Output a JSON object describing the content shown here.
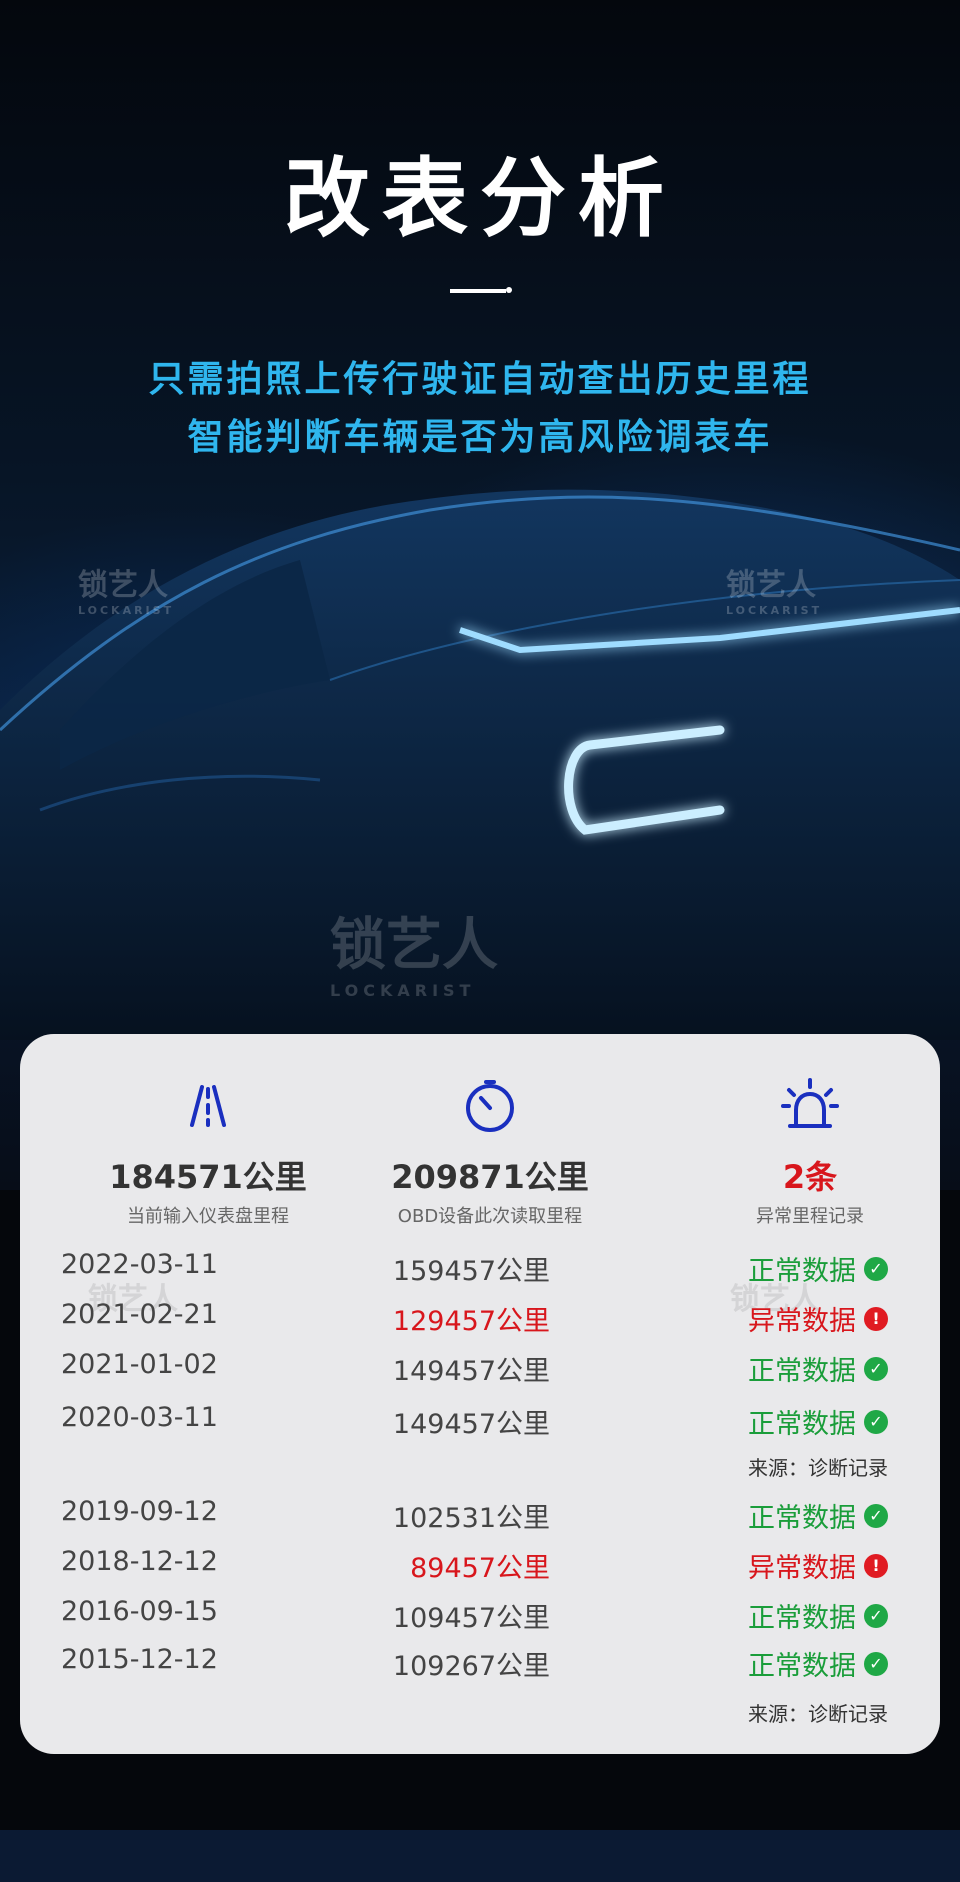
{
  "hero": {
    "title": "改表分析",
    "subtitle_line1": "只需拍照上传行驶证自动查出历史里程",
    "subtitle_line2": "智能判断车辆是否为高风险调表车",
    "watermark": "锁艺人",
    "watermark_sub": "LOCKARIST"
  },
  "colors": {
    "accent": "#2fb6ee",
    "ok": "#1a9d3a",
    "alert": "#d8161c"
  },
  "stats": [
    {
      "icon": "road-icon",
      "value": "184571公里",
      "caption": "当前输入仪表盘里程",
      "highlight": false
    },
    {
      "icon": "stopwatch-icon",
      "value": "209871公里",
      "caption": "OBD设备此次读取里程",
      "highlight": false
    },
    {
      "icon": "alarm-light-icon",
      "value": "2条",
      "caption": "异常里程记录",
      "highlight": true
    }
  ],
  "records_group1": [
    {
      "date": "2022-03-11",
      "km": "159457公里",
      "status": "正常数据",
      "ok": true
    },
    {
      "date": "2021-02-21",
      "km": "129457公里",
      "status": "异常数据",
      "ok": false
    },
    {
      "date": "2021-01-02",
      "km": "149457公里",
      "status": "正常数据",
      "ok": true
    },
    {
      "date": "2020-03-11",
      "km": "149457公里",
      "status": "正常数据",
      "ok": true
    }
  ],
  "source1": "来源：诊断记录",
  "records_group2": [
    {
      "date": "2019-09-12",
      "km": "102531公里",
      "status": "正常数据",
      "ok": true
    },
    {
      "date": "2018-12-12",
      "km": "89457公里",
      "status": "异常数据",
      "ok": false
    },
    {
      "date": "2016-09-15",
      "km": "109457公里",
      "status": "正常数据",
      "ok": true
    },
    {
      "date": "2015-12-12",
      "km": "109267公里",
      "status": "正常数据",
      "ok": true
    }
  ],
  "source2": "来源：诊断记录"
}
